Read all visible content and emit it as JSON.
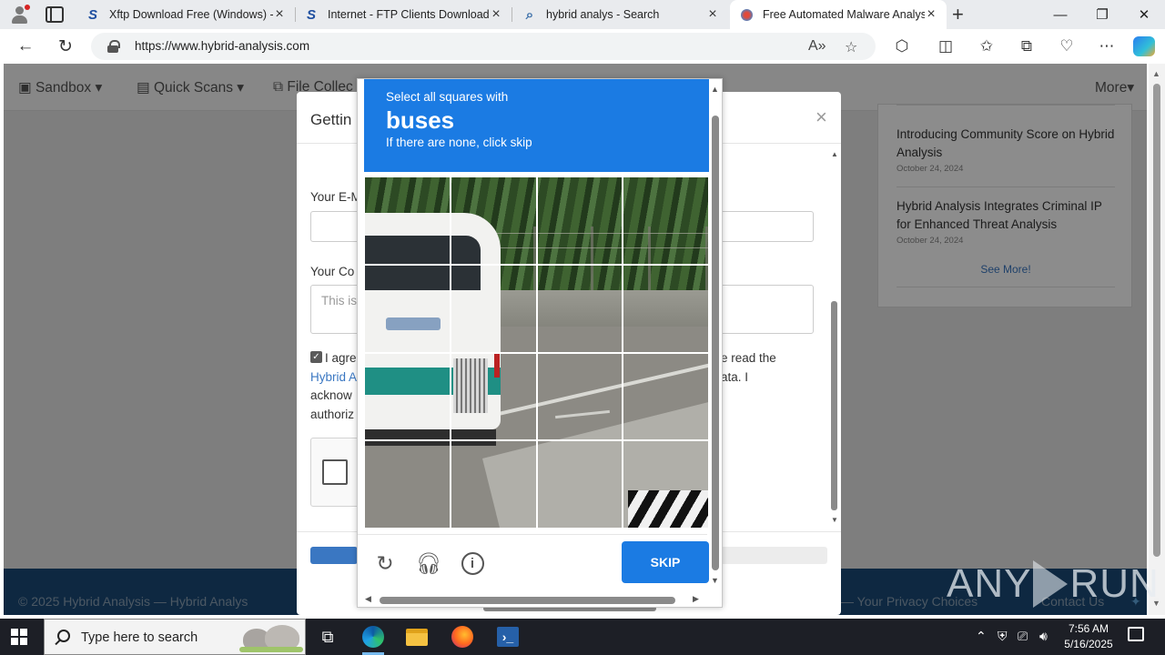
{
  "browser": {
    "tabs": [
      {
        "title": "Xftp Download Free (Windows) -",
        "favicon": "S"
      },
      {
        "title": "Internet - FTP Clients Downloads",
        "favicon": "S"
      },
      {
        "title": "hybrid analys - Search",
        "favicon": "search-icon"
      },
      {
        "title": "Free Automated Malware Analysi",
        "favicon": "hybrid-analysis-icon",
        "active": true
      }
    ],
    "window_controls": {
      "minimize": "—",
      "restore": "❐",
      "close": "✕"
    },
    "url": "https://www.hybrid-analysis.com"
  },
  "site": {
    "nav": {
      "sandbox": "Sandbox",
      "quick_scans": "Quick Scans",
      "file_collections": "File Collec",
      "more": "More"
    },
    "news": [
      {
        "title": "Introducing Community Score on Hybrid Analysis",
        "date": "October 24, 2024"
      },
      {
        "title": "Hybrid Analysis Integrates Criminal IP for Enhanced Threat Analysis",
        "date": "October 24, 2024"
      }
    ],
    "see_more": "See More!",
    "footer": {
      "copyright": "© 2025 Hybrid Analysis — Hybrid Analys",
      "privacy": "— Your Privacy Choices",
      "contact": "Contact Us"
    }
  },
  "modal": {
    "title": "Gettin",
    "email_label": "Your E-M",
    "comment_label": "Your Co",
    "comment_placeholder": "This is",
    "agree_line1_left": "I agre",
    "agree_line1_right": "e read the",
    "agree_link": "Hybrid A",
    "agree_line2_right": "ata. I",
    "agree_line3": "acknow",
    "agree_line4": "authoriz",
    "agreed": true
  },
  "captcha": {
    "prompt_line1": "Select all squares with",
    "target": "buses",
    "prompt_line3": "If there are none, click skip",
    "skip_label": "SKIP",
    "grid_rows": 4,
    "grid_cols": 4,
    "icons": [
      "refresh-icon",
      "headphones-icon",
      "info-icon"
    ]
  },
  "watermark": {
    "text_left": "ANY",
    "text_right": "RUN"
  },
  "taskbar": {
    "search_placeholder": "Type here to search",
    "time": "7:56 AM",
    "date": "5/16/2025"
  },
  "colors": {
    "hcaptcha_blue": "#1b7be3",
    "footer_blue": "#1a4a77",
    "link_blue": "#3a77c2"
  }
}
